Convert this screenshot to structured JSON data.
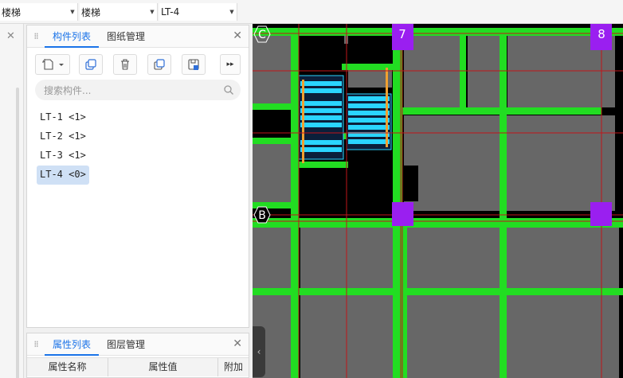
{
  "toolbar": {
    "category": "楼梯",
    "subcategory": "楼梯",
    "component": "LT-4"
  },
  "component_panel": {
    "tabs": [
      "构件列表",
      "图纸管理"
    ],
    "search_placeholder": "搜索构件...",
    "items": [
      "LT-1 <1>",
      "LT-2 <1>",
      "LT-3 <1>",
      "LT-4 <0>"
    ],
    "selected_index": 3
  },
  "property_panel": {
    "tabs": [
      "属性列表",
      "图层管理"
    ],
    "columns": [
      "属性名称",
      "属性值",
      "附加"
    ]
  },
  "canvas": {
    "axis_labels": {
      "c": "C",
      "b": "B",
      "col7": "7",
      "col8": "8"
    },
    "colors": {
      "background": "#000000",
      "slab": "#676767",
      "beam": "#22dd22",
      "column": "#9a1ff0",
      "stair_tread": "#2ad5ff",
      "grid_line": "#c0161a",
      "stair_rail": "#f0a030"
    }
  }
}
